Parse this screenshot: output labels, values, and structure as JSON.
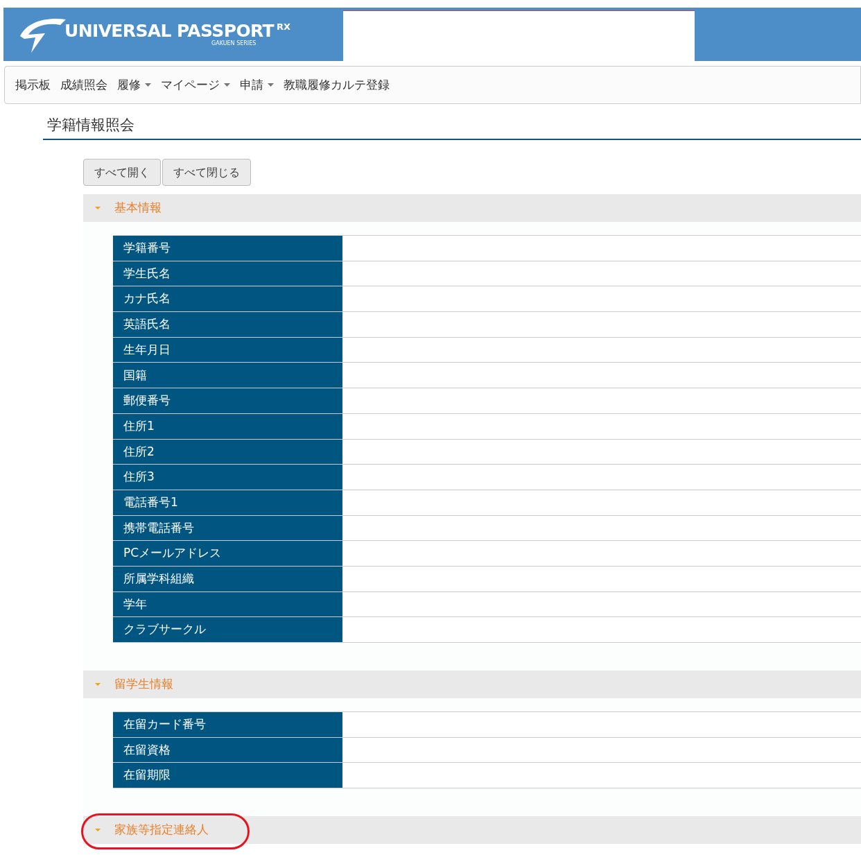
{
  "header": {
    "logo": {
      "name": "UNIVERSAL PASSPORT",
      "suffix": "RX",
      "tagline": "GAKUEN SERIES"
    }
  },
  "nav": [
    {
      "label": "掲示板",
      "has_menu": false
    },
    {
      "label": "成績照会",
      "has_menu": false
    },
    {
      "label": "履修",
      "has_menu": true
    },
    {
      "label": "マイページ",
      "has_menu": true
    },
    {
      "label": "申請",
      "has_menu": true
    },
    {
      "label": "教職履修カルテ登録",
      "has_menu": false
    }
  ],
  "page_title": "学籍情報照会",
  "buttons": [
    "すべて開く",
    "すべて閉じる"
  ],
  "sections": [
    {
      "title": "基本情報",
      "expanded": true,
      "highlighted": false,
      "rows": [
        "学籍番号",
        "学生氏名",
        "カナ氏名",
        "英語氏名",
        "生年月日",
        "国籍",
        "郵便番号",
        "住所1",
        "住所2",
        "住所3",
        "電話番号1",
        "携帯電話番号",
        "PCメールアドレス",
        "所属学科組織",
        "学年",
        "クラブサークル"
      ]
    },
    {
      "title": "留学生情報",
      "expanded": true,
      "highlighted": false,
      "rows": [
        "在留カード番号",
        "在留資格",
        "在留期限"
      ]
    },
    {
      "title": "家族等指定連絡人",
      "expanded": true,
      "highlighted": true
    }
  ]
}
